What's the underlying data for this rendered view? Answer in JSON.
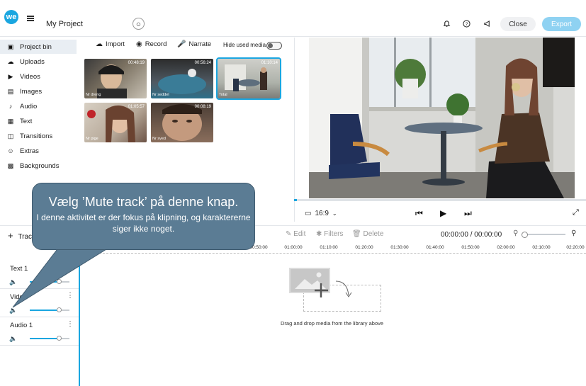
{
  "header": {
    "logo": "we",
    "project_title": "My Project",
    "close_label": "Close",
    "export_label": "Export",
    "icons": [
      "menu-icon",
      "add-collaborator-icon",
      "bell-icon",
      "help-icon",
      "megaphone-icon"
    ]
  },
  "sidebar": {
    "items": [
      {
        "label": "Project bin",
        "icon": "project-bin-icon",
        "active": true
      },
      {
        "label": "Uploads",
        "icon": "cloud-icon"
      },
      {
        "label": "Videos",
        "icon": "video-icon"
      },
      {
        "label": "Images",
        "icon": "image-icon"
      },
      {
        "label": "Audio",
        "icon": "music-icon"
      },
      {
        "label": "Text",
        "icon": "text-icon"
      },
      {
        "label": "Transitions",
        "icon": "transition-icon"
      },
      {
        "label": "Extras",
        "icon": "smiley-icon"
      },
      {
        "label": "Backgrounds",
        "icon": "background-icon"
      }
    ]
  },
  "library": {
    "import_label": "Import",
    "record_label": "Record",
    "narrate_label": "Narrate",
    "hide_used_label": "Hide used media",
    "clips": [
      {
        "name": "Nr dreng",
        "duration": "00:48:19"
      },
      {
        "name": "Nr seddel",
        "duration": "00:56:24"
      },
      {
        "name": "Total",
        "duration": "01:10:14"
      },
      {
        "name": "Nr pige",
        "duration": "01:05:57"
      },
      {
        "name": "Nr sved",
        "duration": "00:08:19"
      }
    ]
  },
  "preview": {
    "aspect_ratio": "16:9",
    "progress": 0.01
  },
  "timeline": {
    "add_track_label": "Track",
    "edit_label": "Edit",
    "filters_label": "Filters",
    "delete_label": "Delete",
    "time_display": "00:00:00 / 00:00:00",
    "ruler_ticks": [
      "00:50:00",
      "01:00:00",
      "01:10:00",
      "01:20:00",
      "01:30:00",
      "01:40:00",
      "01:50:00",
      "02:00:00",
      "02:10:00",
      "02:20:00"
    ],
    "tracks": [
      {
        "name": "Text 1"
      },
      {
        "name": "Video"
      },
      {
        "name": "Audio 1"
      }
    ],
    "empty_hint": "Drag and drop media from the library above"
  },
  "callout": {
    "heading": "Vælg ’Mute track’ på denne knap.",
    "body": "I denne aktivitet er der fokus på klipning, og karaktererne siger ikke noget."
  },
  "colors": {
    "accent": "#1aa6e0",
    "export_button": "#8fd2f2",
    "callout_fill": "#5b7c94"
  }
}
